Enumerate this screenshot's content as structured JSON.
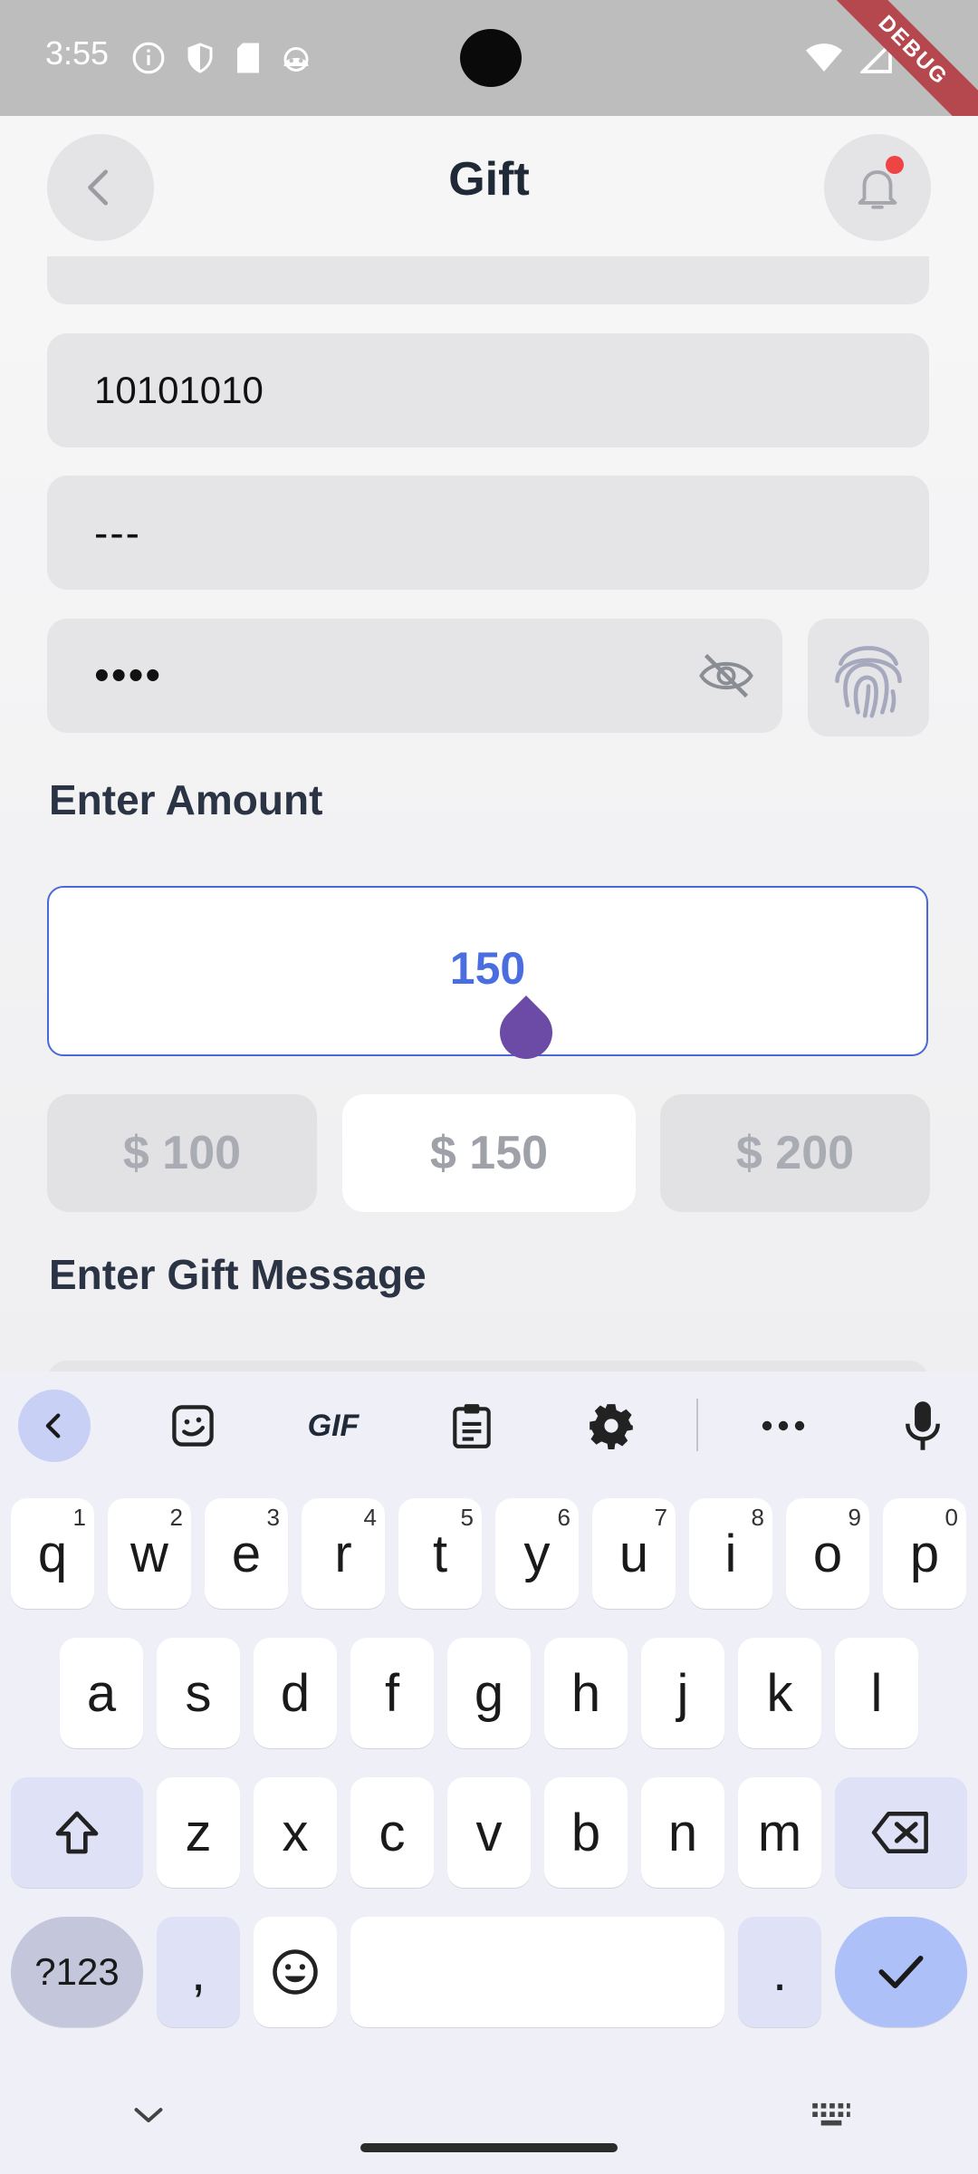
{
  "status_bar": {
    "time": "3:55",
    "debug_banner": "DEBUG"
  },
  "app_bar": {
    "title": "Gift"
  },
  "form": {
    "field_partial": "· · · · ·",
    "field_account": "10101010",
    "field_code": "---",
    "field_pin": "••••",
    "amount_label": "Enter Amount",
    "amount_value": "150",
    "presets": [
      "$ 100",
      "$ 150",
      "$ 200"
    ],
    "selected_preset": "$ 150",
    "message_label": "Enter Gift Message"
  },
  "keyboard": {
    "toolbar": [
      "back",
      "sticker",
      "GIF",
      "clipboard",
      "settings",
      "more",
      "mic"
    ],
    "gif_label": "GIF",
    "row1": [
      {
        "k": "q",
        "h": "1"
      },
      {
        "k": "w",
        "h": "2"
      },
      {
        "k": "e",
        "h": "3"
      },
      {
        "k": "r",
        "h": "4"
      },
      {
        "k": "t",
        "h": "5"
      },
      {
        "k": "y",
        "h": "6"
      },
      {
        "k": "u",
        "h": "7"
      },
      {
        "k": "i",
        "h": "8"
      },
      {
        "k": "o",
        "h": "9"
      },
      {
        "k": "p",
        "h": "0"
      }
    ],
    "row2": [
      "a",
      "s",
      "d",
      "f",
      "g",
      "h",
      "j",
      "k",
      "l"
    ],
    "row3": [
      "z",
      "x",
      "c",
      "v",
      "b",
      "n",
      "m"
    ],
    "symbols_key": "?123",
    "comma_key": ",",
    "period_key": "."
  },
  "colors": {
    "accent": "#4a6ee0",
    "drop": "#6c4ba6",
    "notification": "#ef4444"
  }
}
